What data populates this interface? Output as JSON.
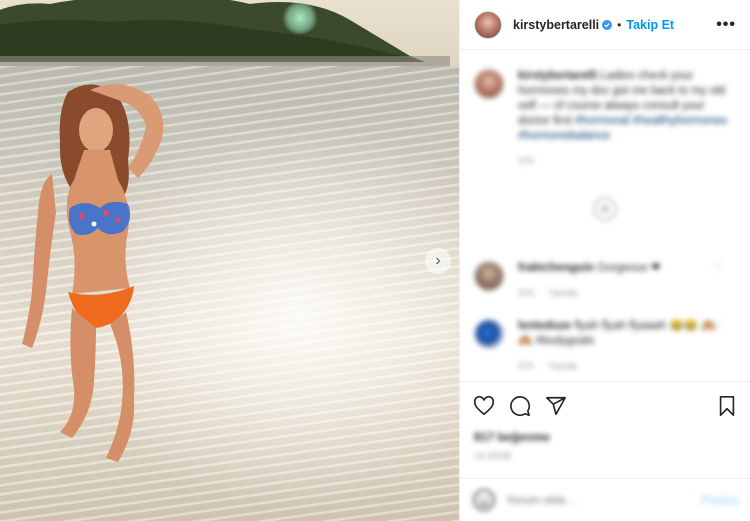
{
  "post": {
    "username": "kirstybertarelli",
    "follow_label": "Takip Et",
    "more_icon": "•••",
    "verified_icon": "verified-badge-icon",
    "next_icon": "›"
  },
  "caption": {
    "username": "kirstybertarelli",
    "text": "Ladies check your hormones my doc got me back to my old self — of course always consult your doctor first",
    "tags": "#hormonal #healthyhormones #hormonebalance",
    "time": "37h"
  },
  "comments": [
    {
      "username": "fraktchenguin",
      "text": "Gorgeous ❤",
      "time": "37h",
      "reply_label": "Yanıtla"
    },
    {
      "username": "lenteduze",
      "text": "flyah flyah flyaaah 😂😂 🙈🙈 #bodygoals",
      "time": "37h",
      "reply_label": "Yanıtla"
    }
  ],
  "actions": {
    "like_icon": "heart-icon",
    "comment_icon": "comment-icon",
    "share_icon": "send-icon",
    "save_icon": "bookmark-icon"
  },
  "stats": {
    "likes": "817 beğenme",
    "date": "16 EKİM"
  },
  "add_comment": {
    "placeholder": "Yorum ekle...",
    "post_label": "Paylaş"
  },
  "colors": {
    "accent": "#0095f6",
    "post_disabled": "#b2dffc",
    "text": "#262626",
    "muted": "#8e8e8e",
    "like_red": "#ed4956"
  }
}
